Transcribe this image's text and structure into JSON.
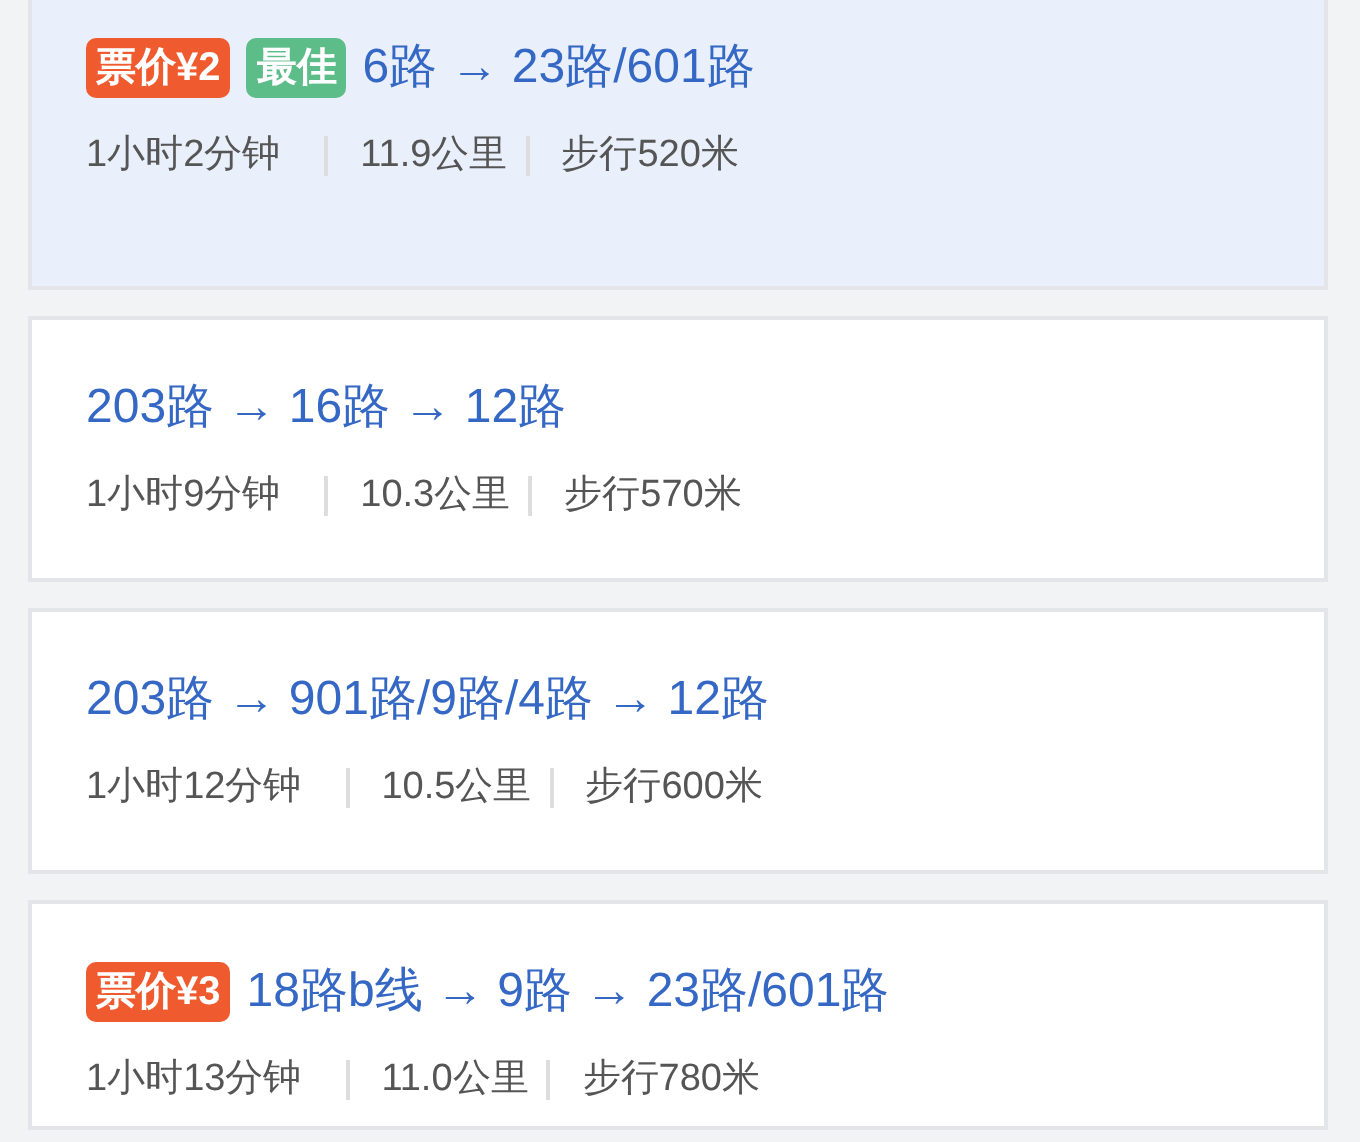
{
  "routes": [
    {
      "selected": true,
      "tags": [
        {
          "kind": "price",
          "text": "票价¥2"
        },
        {
          "kind": "best",
          "text": "最佳"
        }
      ],
      "title": "6路 → 23路/601路",
      "duration": "1小时2分钟",
      "distance": "11.9公里",
      "walk": "步行520米"
    },
    {
      "selected": false,
      "title": "203路 → 16路 → 12路",
      "duration": "1小时9分钟",
      "distance": "10.3公里",
      "walk": "步行570米"
    },
    {
      "selected": false,
      "title": "203路 → 901路/9路/4路 → 12路",
      "duration": "1小时12分钟",
      "distance": "10.5公里",
      "walk": "步行600米"
    },
    {
      "selected": false,
      "tags": [
        {
          "kind": "price",
          "text": "票价¥3"
        }
      ],
      "title": "18路b线 → 9路 → 23路/601路",
      "duration": "1小时13分钟",
      "distance": "11.0公里",
      "walk": "步行780米"
    }
  ]
}
